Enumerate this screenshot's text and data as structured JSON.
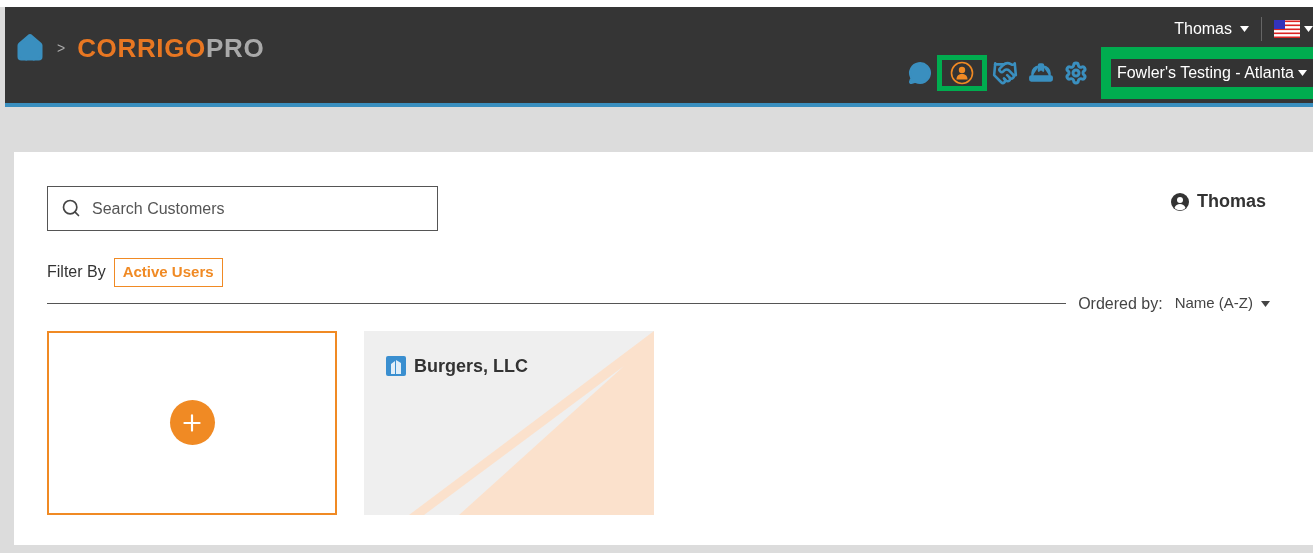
{
  "header": {
    "logo": {
      "brand": "CORRIGO",
      "suffix": "PRO"
    },
    "breadcrumb_separator": ">",
    "user_menu": "Thomas",
    "toolbar": [
      {
        "kind": "chat",
        "highlighted": false
      },
      {
        "kind": "person",
        "highlighted": true
      },
      {
        "kind": "handshake",
        "highlighted": false
      },
      {
        "kind": "hardhat",
        "highlighted": false
      },
      {
        "kind": "settings",
        "highlighted": false
      }
    ],
    "company_selector": {
      "label": "Fowler's Testing - Atlanta",
      "highlighted": true
    }
  },
  "search": {
    "placeholder": "Search Customers"
  },
  "current_user": "Thomas",
  "filter": {
    "label": "Filter By",
    "tag": "Active Users"
  },
  "sort": {
    "label": "Ordered by:",
    "value": "Name (A-Z)"
  },
  "cards": [
    {
      "kind": "add"
    },
    {
      "kind": "customer",
      "name": "Burgers, LLC"
    }
  ]
}
